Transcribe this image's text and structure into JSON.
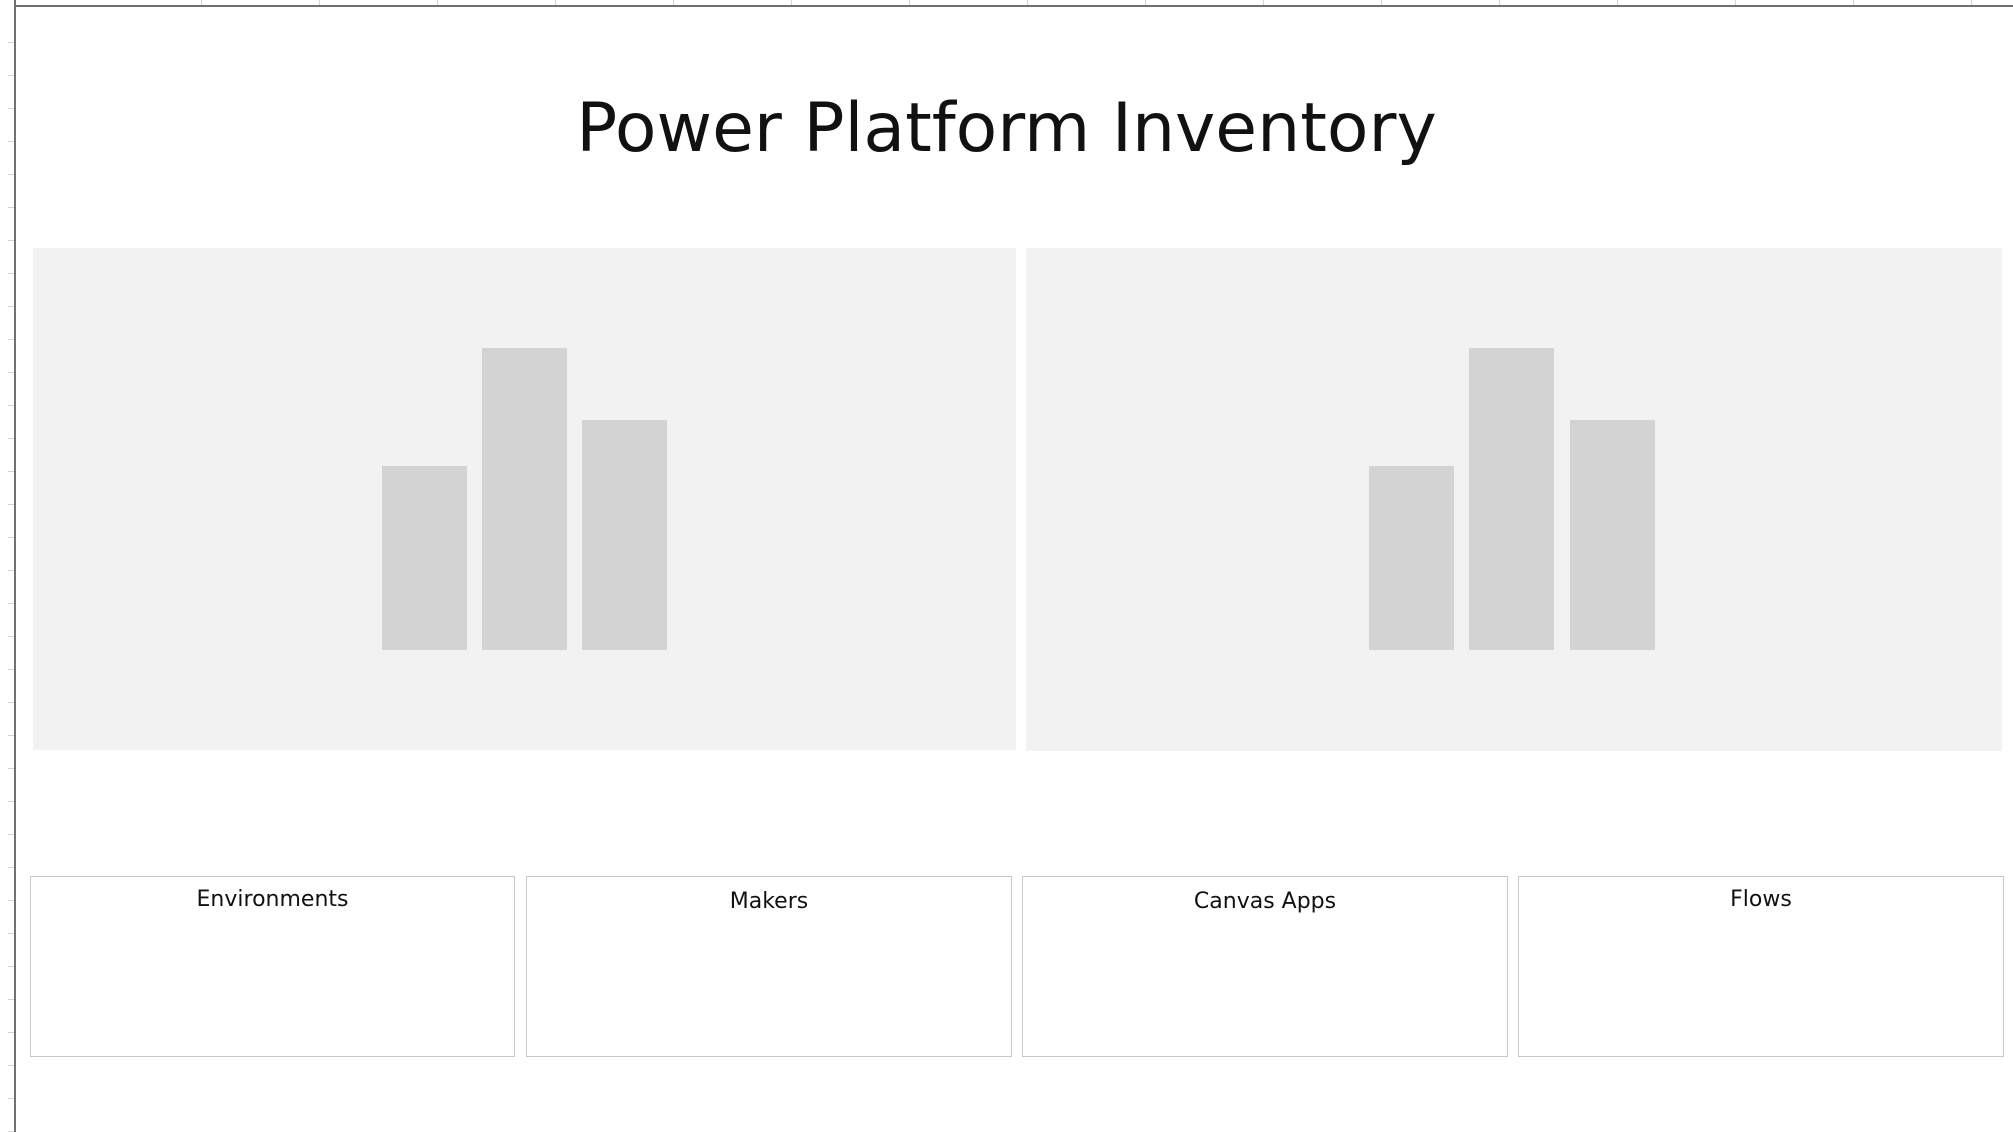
{
  "page": {
    "title": "Power Platform Inventory"
  },
  "charts": [
    {
      "name": "left-chart-placeholder",
      "placeholder_bar_levels": [
        0.61,
        1.0,
        0.76
      ]
    },
    {
      "name": "right-chart-placeholder",
      "placeholder_bar_levels": [
        0.61,
        1.0,
        0.76
      ]
    }
  ],
  "cards": [
    {
      "title": "Environments"
    },
    {
      "title": "Makers"
    },
    {
      "title": "Canvas Apps"
    },
    {
      "title": "Flows"
    }
  ],
  "colors": {
    "placeholder_panel": "#f2f2f2",
    "placeholder_bar": "#d2d3d2",
    "card_border": "#c8c8c8",
    "text": "#111111"
  }
}
